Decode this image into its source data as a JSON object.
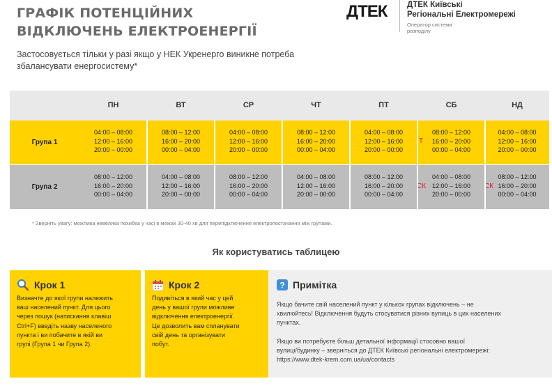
{
  "header": {
    "title_line1": "ГРАФІК ПОТЕНЦІЙНИХ",
    "title_line2": "ВІДКЛЮЧЕНЬ ЕЛЕКТРОЕНЕРГІЇ",
    "subtitle_line1": "Застосовується тільки у разі якщо у НЕК Укренерго виникне потреба",
    "subtitle_line2": "збалансувати енергосистему*"
  },
  "brand": {
    "logo_text": "ДТЕК",
    "name_line1": "ДТЕК Київські",
    "name_line2": "Регіональні Електромережі",
    "sub_line1": "Оператор системи",
    "sub_line2": "розподілу"
  },
  "table": {
    "days": [
      "ПН",
      "ВТ",
      "СР",
      "ЧТ",
      "ПТ",
      "СБ",
      "НД"
    ],
    "groups": [
      {
        "label": "Група 1",
        "slots": [
          [
            "04:00 – 08:00",
            "12:00 – 16:00",
            "20:00 – 00:00"
          ],
          [
            "08:00 – 12:00",
            "16:00 – 20:00",
            "00:00 – 04:00"
          ],
          [
            "04:00 – 08:00",
            "12:00 – 16:00",
            "20:00 – 00:00"
          ],
          [
            "08:00 – 12:00",
            "16:00 – 20:00",
            "00:00 – 04:00"
          ],
          [
            "04:00 – 08:00",
            "12:00 – 16:00",
            "20:00 – 00:00"
          ],
          [
            "08:00 – 12:00",
            "16:00 – 20:00",
            "00:00 – 04:00"
          ],
          [
            "04:00 – 08:00",
            "12:00 – 16:00",
            "20:00 – 00:00"
          ]
        ]
      },
      {
        "label": "Група 2",
        "slots": [
          [
            "08:00 – 12:00",
            "16:00 – 20:00",
            "00:00 – 04:00"
          ],
          [
            "04:00 – 08:00",
            "12:00 – 16:00",
            "20:00 – 00:00"
          ],
          [
            "08:00 – 12:00",
            "16:00 – 20:00",
            "00:00 – 04:00"
          ],
          [
            "04:00 – 08:00",
            "12:00 – 16:00",
            "20:00 – 00:00"
          ],
          [
            "08:00 – 12:00",
            "16:00 – 20:00",
            "00:00 – 04:00"
          ],
          [
            "04:00 – 08:00",
            "12:00 – 16:00",
            "20:00 – 00:00"
          ],
          [
            "08:00 – 12:00",
            "16:00 – 20:00",
            "00:00 – 04:00"
          ]
        ]
      }
    ],
    "marks": {
      "g1_sat": "Т",
      "g2_sat": "СК",
      "g2_sun": "СК"
    }
  },
  "note": "* Зверніть увагу: можлива невелика похибка у часі в межах 30-40 хв для перепідключення електропостачання між групами.",
  "how_title": "Як користуватись таблицею",
  "steps": {
    "step1": {
      "title": "Крок 1",
      "lines": [
        "Визначте до якої групи належить",
        "ваш населений пункт. Для цього",
        "через пошук (натискання клавіш",
        "Ctrl+F) введіть назву населеного",
        "пункта і ви побачите в якій ви",
        "групі (Група 1 чи Група 2)."
      ]
    },
    "step2": {
      "title": "Крок 2",
      "lines": [
        "Подивіться в який час у цей",
        "день у вашої групи можливе",
        "відключення електроенергії.",
        "Це дозволить вам спланувати",
        "свій день та організувати",
        "побут."
      ]
    },
    "remark": {
      "title": "Примітка",
      "lines": [
        "Якщо бачите свій населений пункт у кількох групах відключень – не",
        "хвилюйтесь! Відключення будуть стосуватися різних вулиць в цих населених",
        "пунктах.",
        "",
        "Якщо ви потребуєте більш детальної інформації стосовно вашої",
        "вулиці/будинку – зверніться до ДТЕК Київські регіональні електромережі:",
        "https://www.dtek-krem.com.ua/ua/contacts"
      ]
    }
  },
  "colors": {
    "accent_yellow": "#ffd200",
    "row_gray": "#bdbdbd",
    "mark_red": "#e02020",
    "title_gray": "#6b6b6b"
  },
  "icons": {
    "step1": "magnifier-icon",
    "step2": "calendar-icon",
    "remark": "question-icon"
  }
}
